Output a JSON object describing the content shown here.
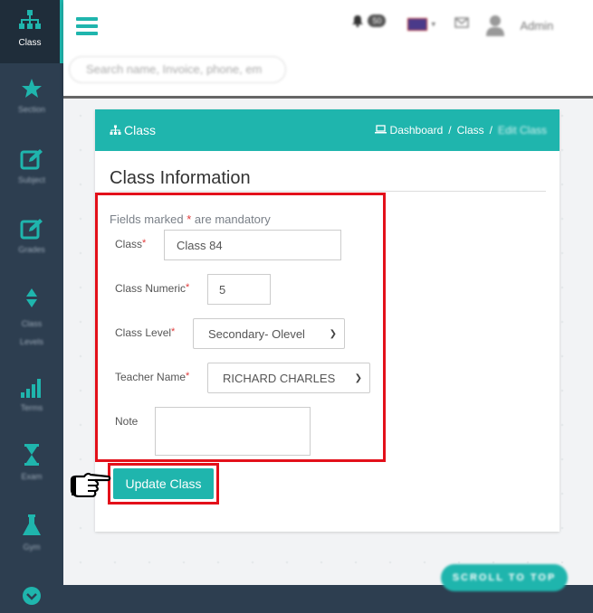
{
  "sidebar": {
    "items": [
      {
        "label": "Class",
        "icon": "sitemap-icon"
      },
      {
        "label": "Section",
        "icon": "star-icon"
      },
      {
        "label": "Subject",
        "icon": "edit-icon"
      },
      {
        "label": "Grades",
        "icon": "edit-icon"
      },
      {
        "label": "Class Levels",
        "icon": "sort-icon"
      },
      {
        "label": "Terms",
        "icon": "signal-icon"
      },
      {
        "label": "Exam",
        "icon": "hourglass-icon"
      },
      {
        "label": "Gym",
        "icon": "flask-icon"
      }
    ]
  },
  "header": {
    "search_placeholder": "Search name, Invoice, phone, em",
    "notification_count": "50",
    "user_name": "Admin"
  },
  "card": {
    "title": "Class",
    "breadcrumb": [
      "Dashboard",
      "Class",
      "Edit Class"
    ]
  },
  "form": {
    "heading": "Class Information",
    "mandatory_note_pre": "Fields marked ",
    "mandatory_star": "*",
    "mandatory_note_post": " are mandatory",
    "fields": {
      "class_label": "Class",
      "class_value": "Class 84",
      "numeric_label": "Class Numeric",
      "numeric_value": "5",
      "level_label": "Class Level",
      "level_value": "Secondary- Olevel",
      "teacher_label": "Teacher Name",
      "teacher_value": "RICHARD CHARLES",
      "note_label": "Note",
      "note_value": ""
    },
    "submit_label": "Update Class"
  },
  "scroll_top_label": "SCROLL TO TOP",
  "colors": {
    "accent": "#1fb5ad",
    "sidebar": "#2d3e50",
    "highlight": "#e3101a",
    "required": "#e13b3b"
  }
}
